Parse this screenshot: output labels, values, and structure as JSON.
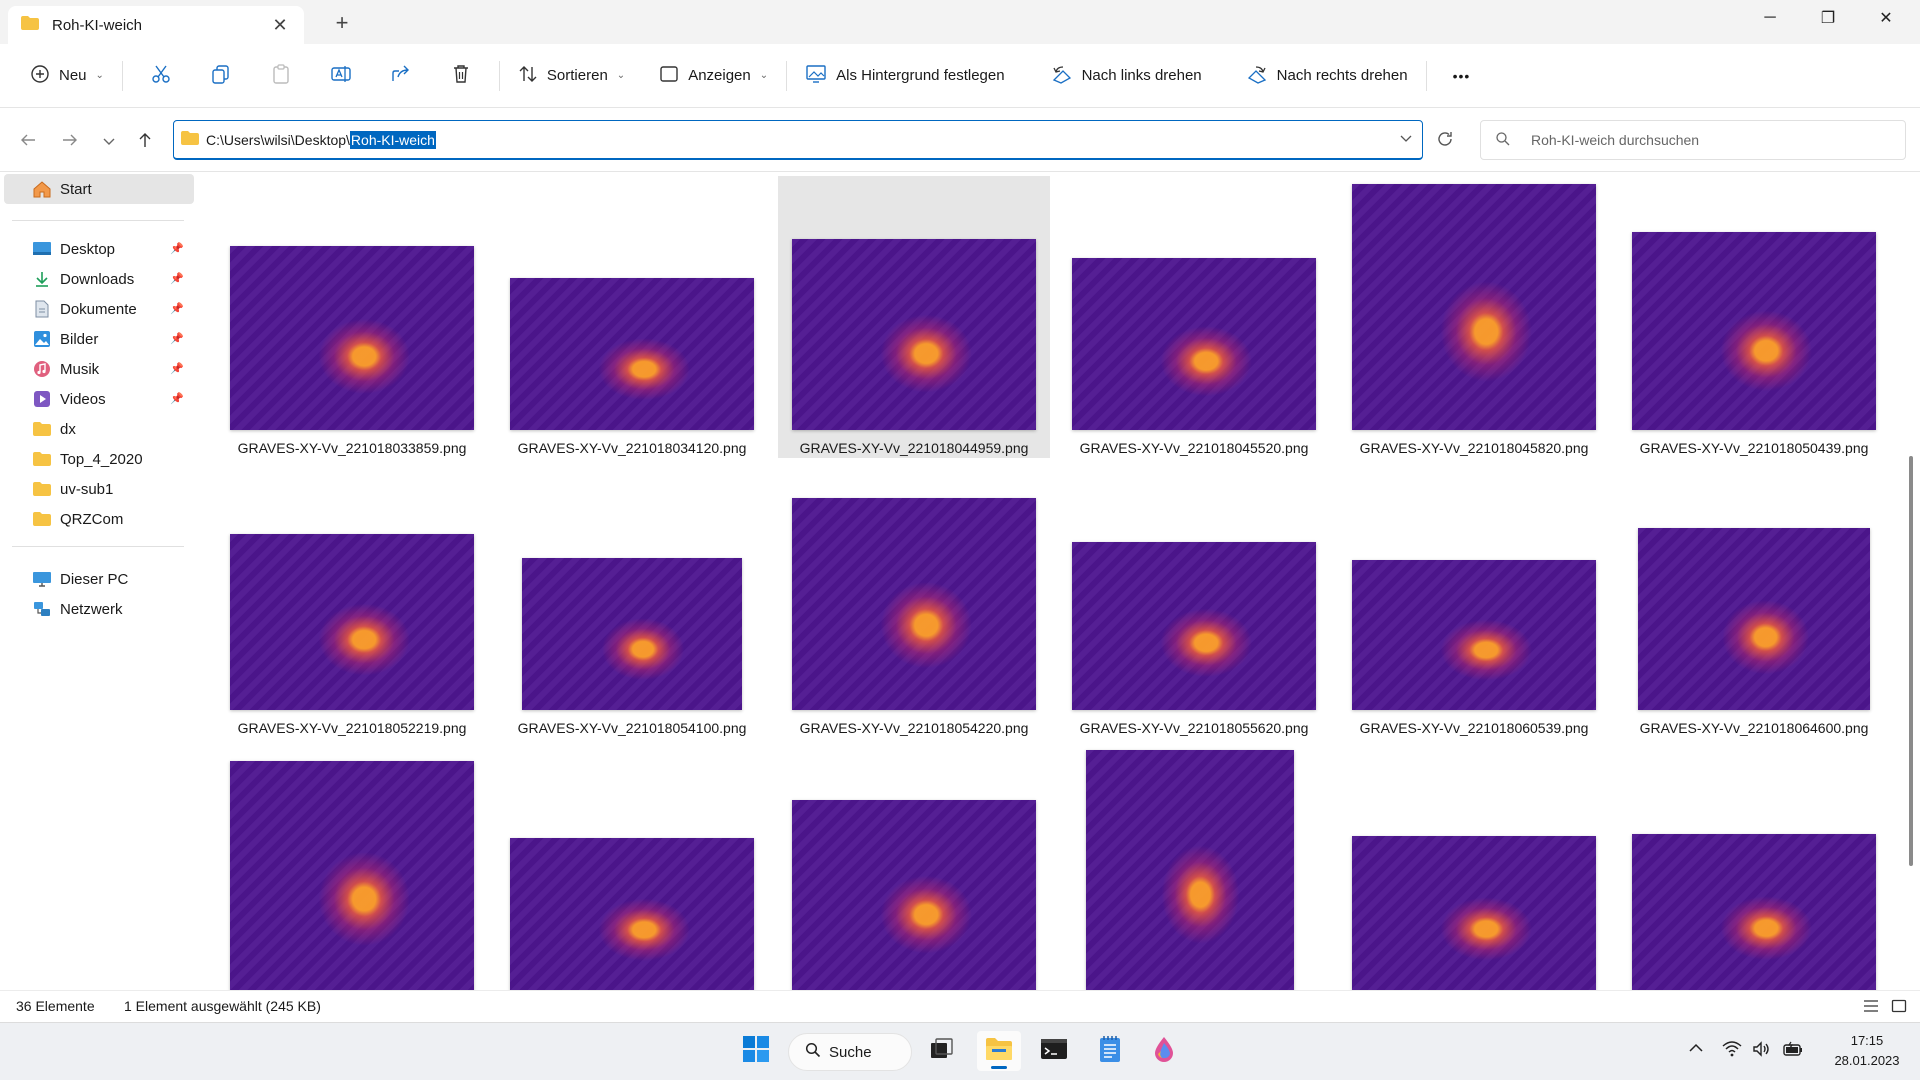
{
  "window": {
    "tab_title": "Roh-KI-weich",
    "tab_close": "✕",
    "new_tab": "+",
    "controls": [
      "─",
      "❐",
      "✕"
    ]
  },
  "toolbar": {
    "new_label": "Neu",
    "sort_label": "Sortieren",
    "view_label": "Anzeigen",
    "set_background_label": "Als Hintergrund festlegen",
    "rotate_left_label": "Nach links drehen",
    "rotate_right_label": "Nach rechts drehen",
    "more_label": "•••"
  },
  "address": {
    "path_prefix": "C:\\Users\\wilsi\\Desktop\\",
    "path_selected": "Roh-KI-weich"
  },
  "search": {
    "placeholder": "Roh-KI-weich durchsuchen"
  },
  "sidebar": {
    "home": "Start",
    "quick_access": [
      {
        "label": "Desktop",
        "icon": "desktop-icon",
        "pinned": true
      },
      {
        "label": "Downloads",
        "icon": "download-icon",
        "pinned": true
      },
      {
        "label": "Dokumente",
        "icon": "document-icon",
        "pinned": true
      },
      {
        "label": "Bilder",
        "icon": "pictures-icon",
        "pinned": true
      },
      {
        "label": "Musik",
        "icon": "music-icon",
        "pinned": true
      },
      {
        "label": "Videos",
        "icon": "video-icon",
        "pinned": true
      },
      {
        "label": "dx",
        "icon": "folder-icon",
        "pinned": false
      },
      {
        "label": "Top_4_2020",
        "icon": "folder-icon",
        "pinned": false
      },
      {
        "label": "uv-sub1",
        "icon": "folder-icon",
        "pinned": false
      },
      {
        "label": "QRZCom",
        "icon": "folder-icon",
        "pinned": false
      }
    ],
    "this_pc": "Dieser PC",
    "network": "Netzwerk"
  },
  "files": [
    {
      "name": "GRAVES-XY-Vv_221018033859.png",
      "selected": false
    },
    {
      "name": "GRAVES-XY-Vv_221018034120.png",
      "selected": false
    },
    {
      "name": "GRAVES-XY-Vv_221018044959.png",
      "selected": true
    },
    {
      "name": "GRAVES-XY-Vv_221018045520.png",
      "selected": false
    },
    {
      "name": "GRAVES-XY-Vv_221018045820.png",
      "selected": false
    },
    {
      "name": "GRAVES-XY-Vv_221018050439.png",
      "selected": false
    },
    {
      "name": "GRAVES-XY-Vv_221018052219.png",
      "selected": false
    },
    {
      "name": "GRAVES-XY-Vv_221018054100.png",
      "selected": false
    },
    {
      "name": "GRAVES-XY-Vv_221018054220.png",
      "selected": false
    },
    {
      "name": "GRAVES-XY-Vv_221018055620.png",
      "selected": false
    },
    {
      "name": "GRAVES-XY-Vv_221018060539.png",
      "selected": false
    },
    {
      "name": "GRAVES-XY-Vv_221018064600.png",
      "selected": false
    }
  ],
  "status": {
    "count": "36 Elemente",
    "selection": "1 Element ausgewählt (245 KB)"
  },
  "taskbar": {
    "search_label": "Suche",
    "time": "17:15",
    "date": "28.01.2023"
  },
  "colors": {
    "accent": "#0067c0",
    "thumbnail_base": "#4e1690",
    "thumbnail_peak": "#ffa028",
    "folder": "#f6c343"
  }
}
